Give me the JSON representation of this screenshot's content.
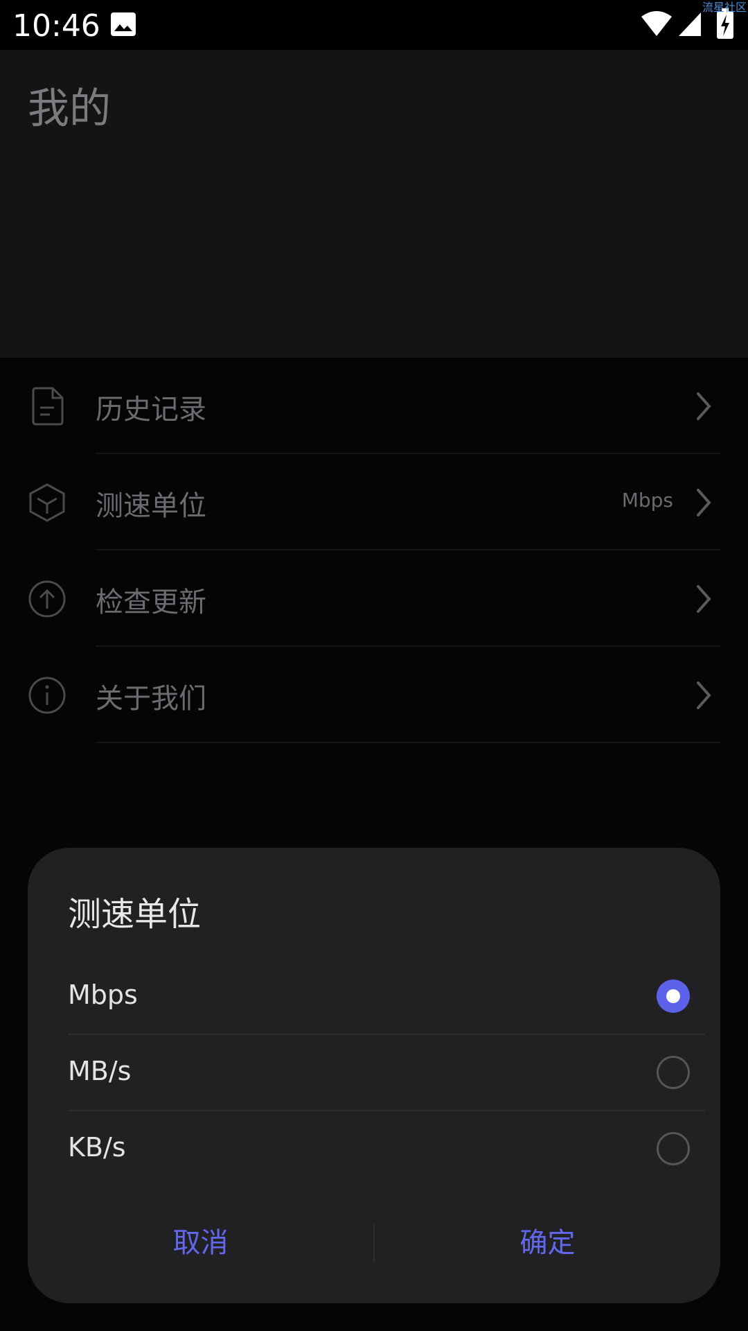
{
  "status_bar": {
    "time": "10:46",
    "watermark": "流星社区",
    "icons": [
      "image-icon",
      "wifi-icon",
      "cellular-signal-icon",
      "battery-charging-icon"
    ]
  },
  "header": {
    "title": "我的"
  },
  "menu": {
    "items": [
      {
        "label": "历史记录",
        "value": "",
        "icon": "document-icon"
      },
      {
        "label": "测速单位",
        "value": "Mbps",
        "icon": "cube-icon"
      },
      {
        "label": "检查更新",
        "value": "",
        "icon": "upload-arrow-icon"
      },
      {
        "label": "关于我们",
        "value": "",
        "icon": "info-icon"
      }
    ]
  },
  "dialog": {
    "title": "测速单位",
    "options": [
      {
        "label": "Mbps",
        "selected": true
      },
      {
        "label": "MB/s",
        "selected": false
      },
      {
        "label": "KB/s",
        "selected": false
      }
    ],
    "cancel_label": "取消",
    "confirm_label": "确定"
  },
  "colors": {
    "accent": "#5b61e8",
    "dialog_bg": "#212123",
    "muted_text": "#6b6b70"
  }
}
